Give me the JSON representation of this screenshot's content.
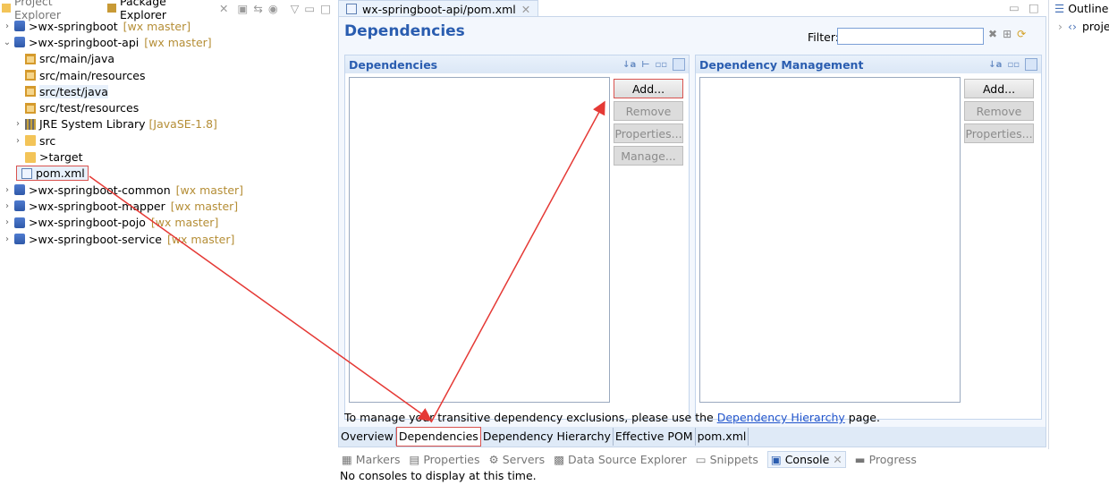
{
  "left_panel": {
    "tabs": [
      {
        "label": "Project Explorer",
        "active": false
      },
      {
        "label": "Package Explorer",
        "active": true
      }
    ],
    "tree": [
      {
        "prefix": "> ",
        "name": "wx-springboot",
        "suffix": "[wx master]",
        "expanded": false
      },
      {
        "prefix": "> ",
        "name": "wx-springboot-api",
        "suffix": "[wx master]",
        "expanded": true
      },
      {
        "name": "src/main/java"
      },
      {
        "name": "src/main/resources"
      },
      {
        "name": "src/test/java"
      },
      {
        "name": "src/test/resources"
      },
      {
        "name": "JRE System Library",
        "suffix": "[JavaSE-1.8]"
      },
      {
        "name": "src"
      },
      {
        "prefix": "> ",
        "name": "target"
      },
      {
        "name": "pom.xml"
      },
      {
        "prefix": "> ",
        "name": "wx-springboot-common",
        "suffix": "[wx master]"
      },
      {
        "prefix": "> ",
        "name": "wx-springboot-mapper",
        "suffix": "[wx master]"
      },
      {
        "prefix": "> ",
        "name": "wx-springboot-pojo",
        "suffix": "[wx master]"
      },
      {
        "prefix": "> ",
        "name": "wx-springboot-service",
        "suffix": "[wx master]"
      }
    ]
  },
  "editor": {
    "tab_title": "wx-springboot-api/pom.xml",
    "page_title": "Dependencies",
    "filter_label": "Filter:",
    "left_section": {
      "title": "Dependencies",
      "buttons": [
        "Add...",
        "Remove",
        "Properties...",
        "Manage..."
      ]
    },
    "right_section": {
      "title": "Dependency Management",
      "buttons": [
        "Add...",
        "Remove",
        "Properties..."
      ]
    },
    "info_text": "To manage your transitive dependency exclusions, please use the",
    "info_link": "Dependency Hierarchy",
    "info_suffix": "page.",
    "page_tabs": [
      "Overview",
      "Dependencies",
      "Dependency Hierarchy",
      "Effective POM",
      "pom.xml"
    ]
  },
  "outline": {
    "title": "Outline",
    "item": "proje"
  },
  "bottom_panel": {
    "tabs": [
      "Markers",
      "Properties",
      "Servers",
      "Data Source Explorer",
      "Snippets",
      "Console",
      "Progress"
    ],
    "active_tab": "Console",
    "message": "No consoles to display at this time."
  },
  "colors": {
    "accent_blue": "#2a5db0",
    "annotation_red": "#e53935",
    "decoration_gold": "#b58e36"
  }
}
